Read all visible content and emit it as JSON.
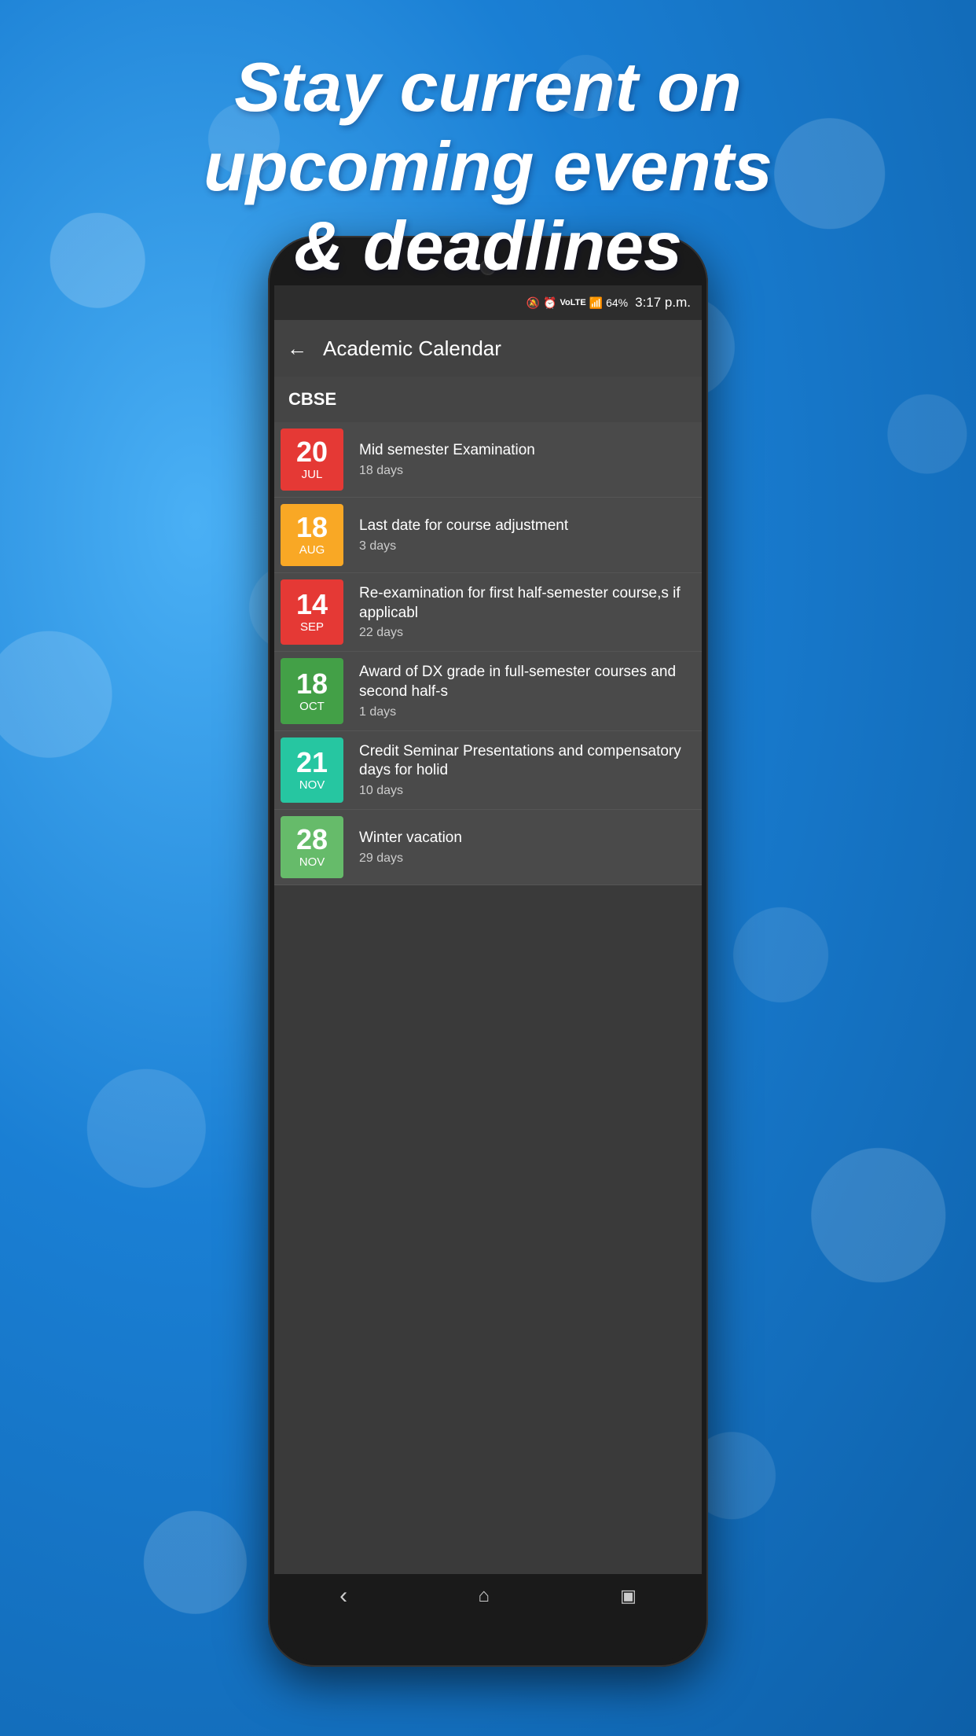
{
  "background": {
    "gradient_start": "#4ab0f5",
    "gradient_end": "#0d5fa8"
  },
  "headline": {
    "line1": "Stay current on",
    "line2": "upcoming events",
    "line3": "& deadlines",
    "full": "Stay current on\nupcoming events\n& deadlines"
  },
  "status_bar": {
    "time": "3:17 p.m.",
    "battery": "64%",
    "signal": "▲"
  },
  "app_bar": {
    "title": "Academic Calendar",
    "back_label": "←"
  },
  "section": {
    "title": "CBSE"
  },
  "calendar_items": [
    {
      "day": "20",
      "month": "JUL",
      "color": "color-red",
      "event": "Mid semester Examination",
      "days": "18 days"
    },
    {
      "day": "18",
      "month": "AUG",
      "color": "color-yellow",
      "event": "Last date for course adjustment",
      "days": "3 days"
    },
    {
      "day": "14",
      "month": "SEP",
      "color": "color-red2",
      "event": "Re-examination for first half-semester course,s if applicabl",
      "days": "22 days"
    },
    {
      "day": "18",
      "month": "OCT",
      "color": "color-green",
      "event": "Award of DX grade in full-semester courses and second half-s",
      "days": "1 days"
    },
    {
      "day": "21",
      "month": "NOV",
      "color": "color-teal",
      "event": "Credit Seminar Presentations and compensatory days for holid",
      "days": "10 days"
    },
    {
      "day": "28",
      "month": "NOV",
      "color": "color-lime",
      "event": "Winter vacation",
      "days": "29 days"
    }
  ],
  "nav": {
    "back": "‹",
    "home": "⌂",
    "recent": "▣"
  }
}
